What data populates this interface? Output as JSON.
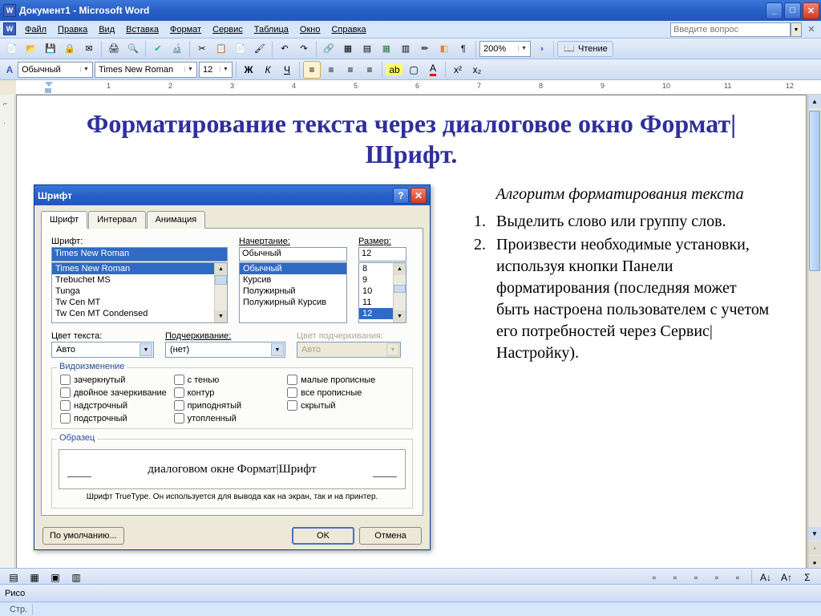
{
  "window": {
    "title": "Документ1 - Microsoft Word",
    "help_placeholder": "Введите вопрос"
  },
  "menu": {
    "file": "Файл",
    "edit": "Правка",
    "view": "Вид",
    "insert": "Вставка",
    "format": "Формат",
    "tools": "Сервис",
    "table": "Таблица",
    "window": "Окно",
    "help": "Справка"
  },
  "toolbar": {
    "zoom": "200%",
    "reading": "Чтение",
    "style": "Обычный",
    "font": "Times New Roman",
    "size": "12"
  },
  "doc": {
    "heading": "Форматирование текста через диалоговое окно Формат|Шрифт.",
    "sub": "Алгоритм форматирования текста",
    "item1": "Выделить слово или группу слов.",
    "item2": "Произвести необходимые установки, используя кнопки Панели форматирования (последняя может быть настроена пользователем с учетом его потребностей через Сервис|Настройку)."
  },
  "dialog": {
    "title": "Шрифт",
    "tab_font": "Шрифт",
    "tab_spacing": "Интервал",
    "tab_anim": "Анимация",
    "font_label": "Шрифт:",
    "font_value": "Times New Roman",
    "font_list": [
      "Times New Roman",
      "Trebuchet MS",
      "Tunga",
      "Tw Cen MT",
      "Tw Cen MT Condensed"
    ],
    "style_label": "Начертание:",
    "style_value": "Обычный",
    "style_list": [
      "Обычный",
      "Курсив",
      "Полужирный",
      "Полужирный Курсив"
    ],
    "size_label": "Размер:",
    "size_value": "12",
    "size_list": [
      "8",
      "9",
      "10",
      "11",
      "12"
    ],
    "color_label": "Цвет текста:",
    "color_value": "Авто",
    "underline_label": "Подчеркивание:",
    "underline_value": "(нет)",
    "ucolor_label": "Цвет подчеркивания:",
    "ucolor_value": "Авто",
    "effects_legend": "Видоизменение",
    "effects": {
      "strike": "зачеркнутый",
      "dstrike": "двойное зачеркивание",
      "sup": "надстрочный",
      "sub": "подстрочный",
      "shadow": "с тенью",
      "outline": "контур",
      "emboss": "приподнятый",
      "engrave": "утопленный",
      "smallcaps": "малые прописные",
      "allcaps": "все прописные",
      "hidden": "скрытый"
    },
    "sample_legend": "Образец",
    "sample_text": "диалоговом окне Формат|Шрифт",
    "hint": "Шрифт TrueType. Он используется для вывода как на экран, так и на принтер.",
    "default_btn": "По умолчанию...",
    "ok": "OK",
    "cancel": "Отмена"
  },
  "status": {
    "page": "Стр.",
    "draw": "Рисо"
  }
}
